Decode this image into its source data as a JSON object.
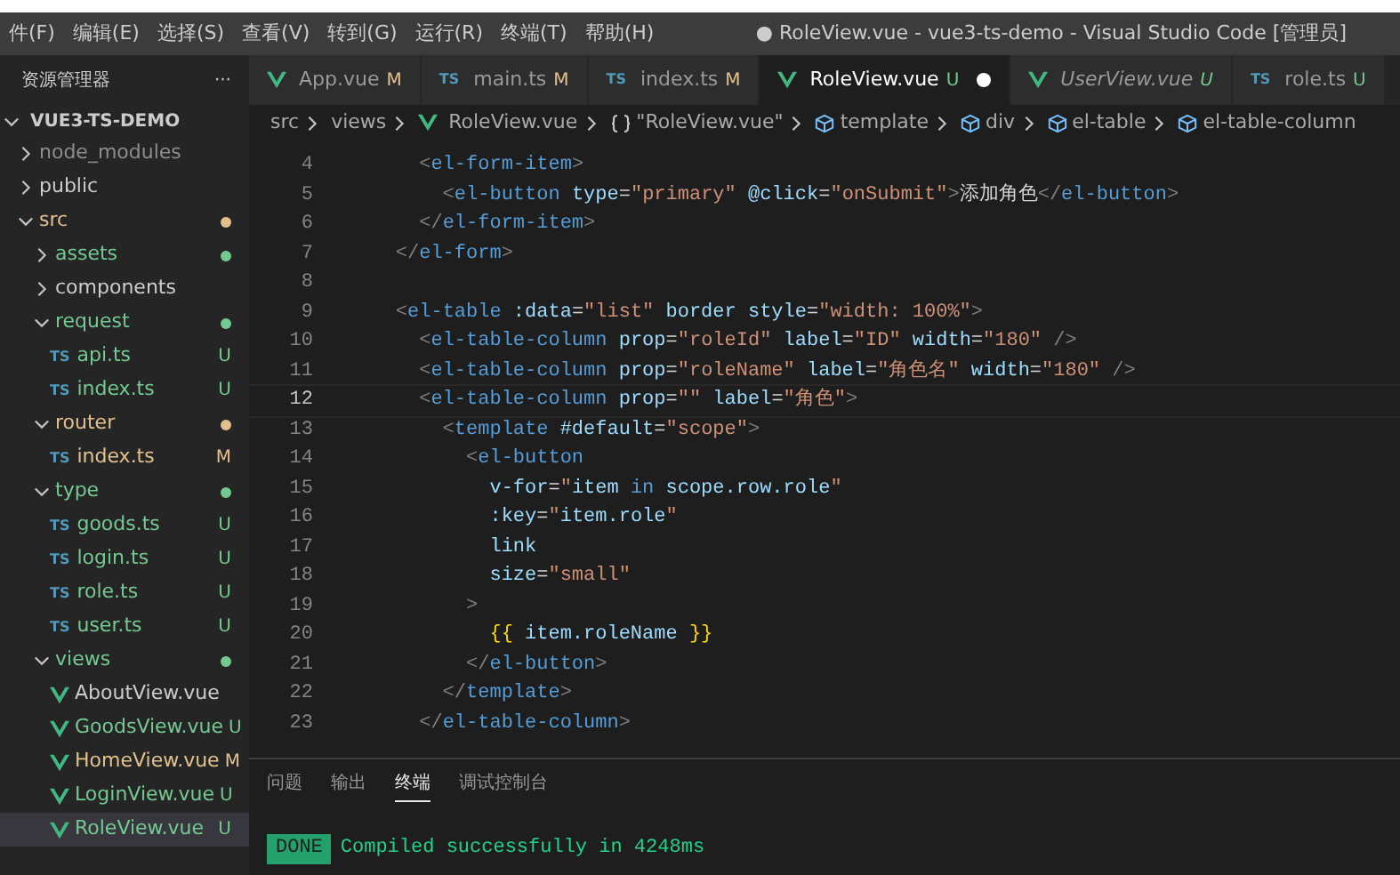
{
  "menu": [
    "件(F)",
    "编辑(E)",
    "选择(S)",
    "查看(V)",
    "转到(G)",
    "运行(R)",
    "终端(T)",
    "帮助(H)"
  ],
  "window": {
    "title": "● RoleView.vue - vue3-ts-demo - Visual Studio Code [管理员]"
  },
  "sidebar": {
    "title": "资源管理器",
    "more": "···",
    "root": {
      "name": "VUE3-TS-DEMO",
      "expanded": true
    },
    "items": [
      {
        "name": "node_modules",
        "kind": "folder",
        "expanded": false,
        "color": "#8c8c8c",
        "selected": false
      },
      {
        "name": "public",
        "kind": "folder",
        "expanded": false,
        "color": "#cccccc",
        "selected": false
      },
      {
        "name": "src",
        "kind": "folder",
        "expanded": true,
        "color": "#e2c08d",
        "dot": true,
        "selected": false,
        "children": [
          {
            "name": "assets",
            "kind": "folder",
            "expanded": false,
            "color": "#73c991",
            "dot": true,
            "selected": false
          },
          {
            "name": "components",
            "kind": "folder",
            "expanded": false,
            "color": "#cccccc",
            "selected": false
          },
          {
            "name": "request",
            "kind": "folder",
            "expanded": true,
            "color": "#73c991",
            "dot": true,
            "selected": false,
            "children": [
              {
                "name": "api.ts",
                "kind": "ts",
                "icon": "TS",
                "color": "#73c991",
                "badge": "U",
                "selected": false
              },
              {
                "name": "index.ts",
                "kind": "ts",
                "icon": "TS",
                "color": "#73c991",
                "badge": "U",
                "selected": false
              }
            ]
          },
          {
            "name": "router",
            "kind": "folder",
            "expanded": true,
            "color": "#e2c08d",
            "dot": true,
            "selected": false,
            "children": [
              {
                "name": "index.ts",
                "kind": "ts",
                "icon": "TS",
                "color": "#e2c08d",
                "badge": "M",
                "selected": false
              }
            ]
          },
          {
            "name": "type",
            "kind": "folder",
            "expanded": true,
            "color": "#73c991",
            "dot": true,
            "selected": false,
            "children": [
              {
                "name": "goods.ts",
                "kind": "ts",
                "icon": "TS",
                "color": "#73c991",
                "badge": "U",
                "selected": false
              },
              {
                "name": "login.ts",
                "kind": "ts",
                "icon": "TS",
                "color": "#73c991",
                "badge": "U",
                "selected": false
              },
              {
                "name": "role.ts",
                "kind": "ts",
                "icon": "TS",
                "color": "#73c991",
                "badge": "U",
                "selected": false
              },
              {
                "name": "user.ts",
                "kind": "ts",
                "icon": "TS",
                "color": "#73c991",
                "badge": "U",
                "selected": false
              }
            ]
          },
          {
            "name": "views",
            "kind": "folder",
            "expanded": true,
            "color": "#73c991",
            "dot": true,
            "selected": false,
            "children": [
              {
                "name": "AboutView.vue",
                "kind": "vue",
                "color": "#cccccc",
                "selected": false
              },
              {
                "name": "GoodsView.vue",
                "kind": "vue",
                "color": "#73c991",
                "badge": "U",
                "selected": false
              },
              {
                "name": "HomeView.vue",
                "kind": "vue",
                "color": "#e2c08d",
                "badge": "M",
                "selected": false
              },
              {
                "name": "LoginView.vue",
                "kind": "vue",
                "color": "#73c991",
                "badge": "U",
                "selected": false
              },
              {
                "name": "RoleView.vue",
                "kind": "vue",
                "color": "#73c991",
                "badge": "U",
                "selected": true
              }
            ]
          }
        ]
      }
    ]
  },
  "tabs": [
    {
      "label": "App.vue",
      "kind": "vue",
      "badge": "M",
      "color": "#e2c08d",
      "selected": false,
      "preview": false,
      "dirty": false
    },
    {
      "label": "main.ts",
      "kind": "ts",
      "icon": "TS",
      "badge": "M",
      "color": "#e2c08d",
      "selected": false,
      "preview": false,
      "dirty": false
    },
    {
      "label": "index.ts",
      "kind": "ts",
      "icon": "TS",
      "badge": "M",
      "color": "#e2c08d",
      "selected": false,
      "preview": false,
      "dirty": false
    },
    {
      "label": "RoleView.vue",
      "kind": "vue",
      "badge": "U",
      "color": "#73c991",
      "selected": true,
      "preview": false,
      "dirty": true
    },
    {
      "label": "UserView.vue",
      "kind": "vue",
      "badge": "U",
      "color": "#73c991",
      "selected": false,
      "preview": true,
      "dirty": false
    },
    {
      "label": "role.ts",
      "kind": "ts",
      "icon": "TS",
      "badge": "U",
      "color": "#73c991",
      "selected": false,
      "preview": false,
      "dirty": false
    }
  ],
  "breadcrumb": [
    {
      "label": "src",
      "kind": "folder"
    },
    {
      "label": "views",
      "kind": "folder"
    },
    {
      "label": "RoleView.vue",
      "kind": "vue"
    },
    {
      "label": "\"RoleView.vue\"",
      "kind": "object"
    },
    {
      "label": "template",
      "kind": "element"
    },
    {
      "label": "div",
      "kind": "element"
    },
    {
      "label": "el-table",
      "kind": "element"
    },
    {
      "label": "el-table-column",
      "kind": "element"
    }
  ],
  "code": [
    {
      "number": "4",
      "current": false,
      "tokens": [
        {
          "kind": "punct",
          "text": "      <"
        },
        {
          "kind": "tag",
          "text": "el-form-item"
        },
        {
          "kind": "punct",
          "text": ">"
        }
      ]
    },
    {
      "number": "5",
      "current": false,
      "tokens": [
        {
          "kind": "punct",
          "text": "        <"
        },
        {
          "kind": "tag",
          "text": "el-button"
        },
        {
          "kind": "attr",
          "text": " type"
        },
        {
          "kind": "plain",
          "text": "="
        },
        {
          "kind": "string",
          "text": "\"primary\""
        },
        {
          "kind": "attr",
          "text": " @click"
        },
        {
          "kind": "plain",
          "text": "="
        },
        {
          "kind": "string",
          "text": "\"onSubmit\""
        },
        {
          "kind": "punct",
          "text": ">"
        },
        {
          "kind": "plain",
          "text": "添加角色"
        },
        {
          "kind": "punct",
          "text": "</"
        },
        {
          "kind": "tag",
          "text": "el-button"
        },
        {
          "kind": "punct",
          "text": ">"
        }
      ]
    },
    {
      "number": "6",
      "current": false,
      "tokens": [
        {
          "kind": "punct",
          "text": "      </"
        },
        {
          "kind": "tag",
          "text": "el-form-item"
        },
        {
          "kind": "punct",
          "text": ">"
        }
      ]
    },
    {
      "number": "7",
      "current": false,
      "tokens": [
        {
          "kind": "punct",
          "text": "    </"
        },
        {
          "kind": "tag",
          "text": "el-form"
        },
        {
          "kind": "punct",
          "text": ">"
        }
      ]
    },
    {
      "number": "8",
      "current": false
    },
    {
      "number": "9",
      "current": false,
      "tokens": [
        {
          "kind": "punct",
          "text": "    <"
        },
        {
          "kind": "tag",
          "text": "el-table"
        },
        {
          "kind": "attr",
          "text": " :data"
        },
        {
          "kind": "plain",
          "text": "="
        },
        {
          "kind": "string",
          "text": "\"list\""
        },
        {
          "kind": "attr",
          "text": " border style"
        },
        {
          "kind": "plain",
          "text": "="
        },
        {
          "kind": "string",
          "text": "\"width: 100%\""
        },
        {
          "kind": "punct",
          "text": ">"
        }
      ]
    },
    {
      "number": "10",
      "current": false,
      "tokens": [
        {
          "kind": "punct",
          "text": "      <"
        },
        {
          "kind": "tag",
          "text": "el-table-column"
        },
        {
          "kind": "attr",
          "text": " prop"
        },
        {
          "kind": "plain",
          "text": "="
        },
        {
          "kind": "string",
          "text": "\"roleId\""
        },
        {
          "kind": "attr",
          "text": " label"
        },
        {
          "kind": "plain",
          "text": "="
        },
        {
          "kind": "string",
          "text": "\"ID\""
        },
        {
          "kind": "attr",
          "text": " width"
        },
        {
          "kind": "plain",
          "text": "="
        },
        {
          "kind": "string",
          "text": "\"180\""
        },
        {
          "kind": "punct",
          "text": " />"
        }
      ]
    },
    {
      "number": "11",
      "current": false,
      "tokens": [
        {
          "kind": "punct",
          "text": "      <"
        },
        {
          "kind": "tag",
          "text": "el-table-column"
        },
        {
          "kind": "attr",
          "text": " prop"
        },
        {
          "kind": "plain",
          "text": "="
        },
        {
          "kind": "string",
          "text": "\"roleName\""
        },
        {
          "kind": "attr",
          "text": " label"
        },
        {
          "kind": "plain",
          "text": "="
        },
        {
          "kind": "string",
          "text": "\"角色名\""
        },
        {
          "kind": "attr",
          "text": " width"
        },
        {
          "kind": "plain",
          "text": "="
        },
        {
          "kind": "string",
          "text": "\"180\""
        },
        {
          "kind": "punct",
          "text": " />"
        }
      ]
    },
    {
      "number": "12",
      "current": true,
      "tokens": [
        {
          "kind": "punct",
          "text": "      <"
        },
        {
          "kind": "tag",
          "text": "el-table-column"
        },
        {
          "kind": "attr",
          "text": " prop"
        },
        {
          "kind": "plain",
          "text": "="
        },
        {
          "kind": "string",
          "text": "\"\""
        },
        {
          "kind": "attr",
          "text": " label"
        },
        {
          "kind": "plain",
          "text": "="
        },
        {
          "kind": "string",
          "text": "\"角色\""
        },
        {
          "kind": "punct",
          "text": ">"
        }
      ]
    },
    {
      "number": "13",
      "current": false,
      "tokens": [
        {
          "kind": "punct",
          "text": "        <"
        },
        {
          "kind": "tag",
          "text": "template"
        },
        {
          "kind": "attr",
          "text": " #default"
        },
        {
          "kind": "plain",
          "text": "="
        },
        {
          "kind": "string",
          "text": "\"scope\""
        },
        {
          "kind": "punct",
          "text": ">"
        }
      ]
    },
    {
      "number": "14",
      "current": false,
      "tokens": [
        {
          "kind": "punct",
          "text": "          <"
        },
        {
          "kind": "tag",
          "text": "el-button"
        }
      ]
    },
    {
      "number": "15",
      "current": false,
      "tokens": [
        {
          "kind": "attr",
          "text": "            v-for"
        },
        {
          "kind": "plain",
          "text": "="
        },
        {
          "kind": "string",
          "text": "\""
        },
        {
          "kind": "var",
          "text": "item "
        },
        {
          "kind": "tag",
          "text": "in"
        },
        {
          "kind": "var",
          "text": " scope.row.role"
        },
        {
          "kind": "string",
          "text": "\""
        }
      ]
    },
    {
      "number": "16",
      "current": false,
      "tokens": [
        {
          "kind": "attr",
          "text": "            :key"
        },
        {
          "kind": "plain",
          "text": "="
        },
        {
          "kind": "string",
          "text": "\""
        },
        {
          "kind": "var",
          "text": "item.role"
        },
        {
          "kind": "string",
          "text": "\""
        }
      ]
    },
    {
      "number": "17",
      "current": false,
      "tokens": [
        {
          "kind": "attr",
          "text": "            link"
        }
      ]
    },
    {
      "number": "18",
      "current": false,
      "tokens": [
        {
          "kind": "attr",
          "text": "            size"
        },
        {
          "kind": "plain",
          "text": "="
        },
        {
          "kind": "string",
          "text": "\"small\""
        }
      ]
    },
    {
      "number": "19",
      "current": false,
      "tokens": [
        {
          "kind": "punct",
          "text": "          >"
        }
      ]
    },
    {
      "number": "20",
      "current": false,
      "tokens": [
        {
          "kind": "brace",
          "text": "            {{"
        },
        {
          "kind": "var",
          "text": " item.roleName "
        },
        {
          "kind": "brace",
          "text": "}}"
        }
      ]
    },
    {
      "number": "21",
      "current": false,
      "tokens": [
        {
          "kind": "punct",
          "text": "          </"
        },
        {
          "kind": "tag",
          "text": "el-button"
        },
        {
          "kind": "punct",
          "text": ">"
        }
      ]
    },
    {
      "number": "22",
      "current": false,
      "tokens": [
        {
          "kind": "punct",
          "text": "        </"
        },
        {
          "kind": "tag",
          "text": "template"
        },
        {
          "kind": "punct",
          "text": ">"
        }
      ]
    },
    {
      "number": "23",
      "current": false,
      "tokens": [
        {
          "kind": "punct",
          "text": "      </"
        },
        {
          "kind": "tag",
          "text": "el-table-column"
        },
        {
          "kind": "punct",
          "text": ">"
        }
      ]
    }
  ],
  "panel": {
    "tabs": [
      {
        "label": "问题",
        "selected": false
      },
      {
        "label": "输出",
        "selected": false
      },
      {
        "label": "终端",
        "selected": true
      },
      {
        "label": "调试控制台",
        "selected": false
      }
    ],
    "terminal": {
      "badge": "DONE",
      "message": "Compiled successfully in 4248ms"
    }
  }
}
